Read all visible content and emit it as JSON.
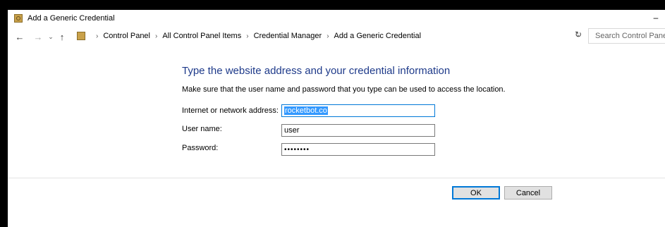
{
  "window": {
    "title": "Add a Generic Credential",
    "minimize_glyph": "–"
  },
  "nav": {
    "back_glyph": "←",
    "forward_glyph": "→",
    "recent_glyph": "⌄",
    "up_glyph": "↑",
    "refresh_glyph": "↻",
    "dropdown_glyph": "⌄",
    "separator": "›"
  },
  "breadcrumb": {
    "items": [
      "Control Panel",
      "All Control Panel Items",
      "Credential Manager",
      "Add a Generic Credential"
    ]
  },
  "search": {
    "placeholder": "Search Control Panel"
  },
  "form": {
    "heading": "Type the website address and your credential information",
    "description": "Make sure that the user name and password that you type can be used to access the location.",
    "address_label": "Internet or network address:",
    "address_value": "rocketbot.co",
    "username_label": "User name:",
    "username_value": "user",
    "password_label": "Password:",
    "password_value": "••••••••"
  },
  "buttons": {
    "ok": "OK",
    "cancel": "Cancel"
  },
  "colors": {
    "heading": "#1e3a8a",
    "focus_border": "#0078d7",
    "selection": "#3399ff"
  }
}
